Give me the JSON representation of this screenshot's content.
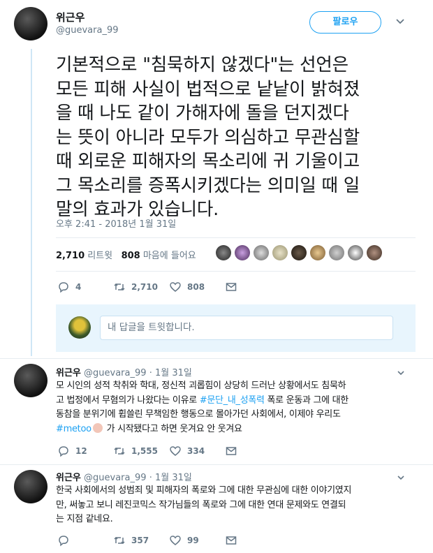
{
  "author": {
    "name": "위근우",
    "handle": "@guevara_99"
  },
  "follow_label": "팔로우",
  "tweet": {
    "lines": [
      "기본적으로 \"침묵하지 않겠다\"는 선언은",
      "모든 피해 사실이 법적으로 낱낱이 밝혀졌",
      "을 때 나도 같이 가해자에 돌을 던지겠다",
      "는 뜻이 아니라 모두가 의심하고 무관심할",
      "때 외로운 피해자의 목소리에 귀 기울이고",
      "그 목소리를 증폭시키겠다는 의미일 때 일",
      "말의 효과가 있습니다."
    ],
    "timestamp": "오후 2:41 - 2018년 1월 31일",
    "retweets_count": "2,710",
    "retweets_label": "리트윗",
    "likes_count": "808",
    "likes_label": "마음에 들어요",
    "replies_action": "4",
    "retweets_action": "2,710",
    "likes_action": "808"
  },
  "reply_placeholder": "내 답글을 트윗합니다.",
  "replies": [
    {
      "name": "위근우",
      "handle": "@guevara_99",
      "date": "1월 31일",
      "line1": "모 시인의 성적 착취와 학대, 정신적 괴롭힘이 상당히 드러난 상황에서도 침묵하",
      "line2": "고 법정에서 무혐의가 나왔다는 이유로 ",
      "hashtag1": "#문단_내_성폭력",
      "line2b": " 폭로 운동과 그에 대한",
      "line3": "동참을 분위기에 휩쓸린 무책임한 행동으로 몰아가던 사회에서, 이제야 우리도",
      "hashtag2": "#metoo",
      "line4b": " 가 시작됐다고 하면 웃겨요 안 웃겨요",
      "reply_count": "12",
      "retweet_count": "1,555",
      "like_count": "334"
    },
    {
      "name": "위근우",
      "handle": "@guevara_99",
      "date": "1월 31일",
      "line1": "한국 사회에서의 성범죄 및 피해자의 폭로와 그에 대한 무관심에 대한 이야기였지",
      "line2": "만, 써놓고 보니 레진코믹스 작가님들의 폭로와 그에 대한 연대 문제와도 연결되",
      "line3": "는 지점 같네요.",
      "reply_count": "",
      "retweet_count": "357",
      "like_count": "99"
    }
  ],
  "icons": [
    "reply-icon",
    "retweet-icon",
    "heart-icon",
    "chevron-down-icon"
  ],
  "colors": {
    "accent": "#1da1f2",
    "muted": "#657786",
    "text": "#14171a",
    "reply_bg": "#e8f5fd"
  }
}
